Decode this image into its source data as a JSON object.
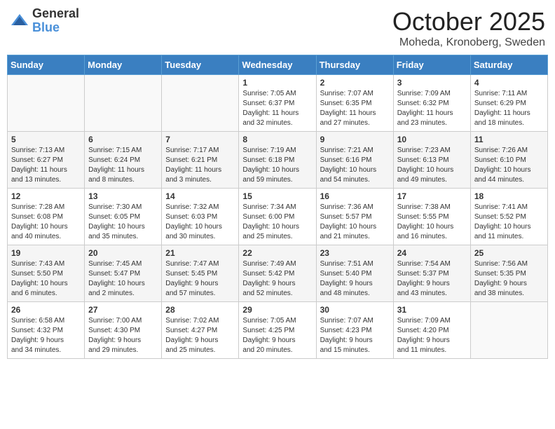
{
  "header": {
    "logo_general": "General",
    "logo_blue": "Blue",
    "month": "October 2025",
    "location": "Moheda, Kronoberg, Sweden"
  },
  "weekdays": [
    "Sunday",
    "Monday",
    "Tuesday",
    "Wednesday",
    "Thursday",
    "Friday",
    "Saturday"
  ],
  "weeks": [
    [
      {
        "day": "",
        "info": ""
      },
      {
        "day": "",
        "info": ""
      },
      {
        "day": "",
        "info": ""
      },
      {
        "day": "1",
        "info": "Sunrise: 7:05 AM\nSunset: 6:37 PM\nDaylight: 11 hours\nand 32 minutes."
      },
      {
        "day": "2",
        "info": "Sunrise: 7:07 AM\nSunset: 6:35 PM\nDaylight: 11 hours\nand 27 minutes."
      },
      {
        "day": "3",
        "info": "Sunrise: 7:09 AM\nSunset: 6:32 PM\nDaylight: 11 hours\nand 23 minutes."
      },
      {
        "day": "4",
        "info": "Sunrise: 7:11 AM\nSunset: 6:29 PM\nDaylight: 11 hours\nand 18 minutes."
      }
    ],
    [
      {
        "day": "5",
        "info": "Sunrise: 7:13 AM\nSunset: 6:27 PM\nDaylight: 11 hours\nand 13 minutes."
      },
      {
        "day": "6",
        "info": "Sunrise: 7:15 AM\nSunset: 6:24 PM\nDaylight: 11 hours\nand 8 minutes."
      },
      {
        "day": "7",
        "info": "Sunrise: 7:17 AM\nSunset: 6:21 PM\nDaylight: 11 hours\nand 3 minutes."
      },
      {
        "day": "8",
        "info": "Sunrise: 7:19 AM\nSunset: 6:18 PM\nDaylight: 10 hours\nand 59 minutes."
      },
      {
        "day": "9",
        "info": "Sunrise: 7:21 AM\nSunset: 6:16 PM\nDaylight: 10 hours\nand 54 minutes."
      },
      {
        "day": "10",
        "info": "Sunrise: 7:23 AM\nSunset: 6:13 PM\nDaylight: 10 hours\nand 49 minutes."
      },
      {
        "day": "11",
        "info": "Sunrise: 7:26 AM\nSunset: 6:10 PM\nDaylight: 10 hours\nand 44 minutes."
      }
    ],
    [
      {
        "day": "12",
        "info": "Sunrise: 7:28 AM\nSunset: 6:08 PM\nDaylight: 10 hours\nand 40 minutes."
      },
      {
        "day": "13",
        "info": "Sunrise: 7:30 AM\nSunset: 6:05 PM\nDaylight: 10 hours\nand 35 minutes."
      },
      {
        "day": "14",
        "info": "Sunrise: 7:32 AM\nSunset: 6:03 PM\nDaylight: 10 hours\nand 30 minutes."
      },
      {
        "day": "15",
        "info": "Sunrise: 7:34 AM\nSunset: 6:00 PM\nDaylight: 10 hours\nand 25 minutes."
      },
      {
        "day": "16",
        "info": "Sunrise: 7:36 AM\nSunset: 5:57 PM\nDaylight: 10 hours\nand 21 minutes."
      },
      {
        "day": "17",
        "info": "Sunrise: 7:38 AM\nSunset: 5:55 PM\nDaylight: 10 hours\nand 16 minutes."
      },
      {
        "day": "18",
        "info": "Sunrise: 7:41 AM\nSunset: 5:52 PM\nDaylight: 10 hours\nand 11 minutes."
      }
    ],
    [
      {
        "day": "19",
        "info": "Sunrise: 7:43 AM\nSunset: 5:50 PM\nDaylight: 10 hours\nand 6 minutes."
      },
      {
        "day": "20",
        "info": "Sunrise: 7:45 AM\nSunset: 5:47 PM\nDaylight: 10 hours\nand 2 minutes."
      },
      {
        "day": "21",
        "info": "Sunrise: 7:47 AM\nSunset: 5:45 PM\nDaylight: 9 hours\nand 57 minutes."
      },
      {
        "day": "22",
        "info": "Sunrise: 7:49 AM\nSunset: 5:42 PM\nDaylight: 9 hours\nand 52 minutes."
      },
      {
        "day": "23",
        "info": "Sunrise: 7:51 AM\nSunset: 5:40 PM\nDaylight: 9 hours\nand 48 minutes."
      },
      {
        "day": "24",
        "info": "Sunrise: 7:54 AM\nSunset: 5:37 PM\nDaylight: 9 hours\nand 43 minutes."
      },
      {
        "day": "25",
        "info": "Sunrise: 7:56 AM\nSunset: 5:35 PM\nDaylight: 9 hours\nand 38 minutes."
      }
    ],
    [
      {
        "day": "26",
        "info": "Sunrise: 6:58 AM\nSunset: 4:32 PM\nDaylight: 9 hours\nand 34 minutes."
      },
      {
        "day": "27",
        "info": "Sunrise: 7:00 AM\nSunset: 4:30 PM\nDaylight: 9 hours\nand 29 minutes."
      },
      {
        "day": "28",
        "info": "Sunrise: 7:02 AM\nSunset: 4:27 PM\nDaylight: 9 hours\nand 25 minutes."
      },
      {
        "day": "29",
        "info": "Sunrise: 7:05 AM\nSunset: 4:25 PM\nDaylight: 9 hours\nand 20 minutes."
      },
      {
        "day": "30",
        "info": "Sunrise: 7:07 AM\nSunset: 4:23 PM\nDaylight: 9 hours\nand 15 minutes."
      },
      {
        "day": "31",
        "info": "Sunrise: 7:09 AM\nSunset: 4:20 PM\nDaylight: 9 hours\nand 11 minutes."
      },
      {
        "day": "",
        "info": ""
      }
    ]
  ]
}
